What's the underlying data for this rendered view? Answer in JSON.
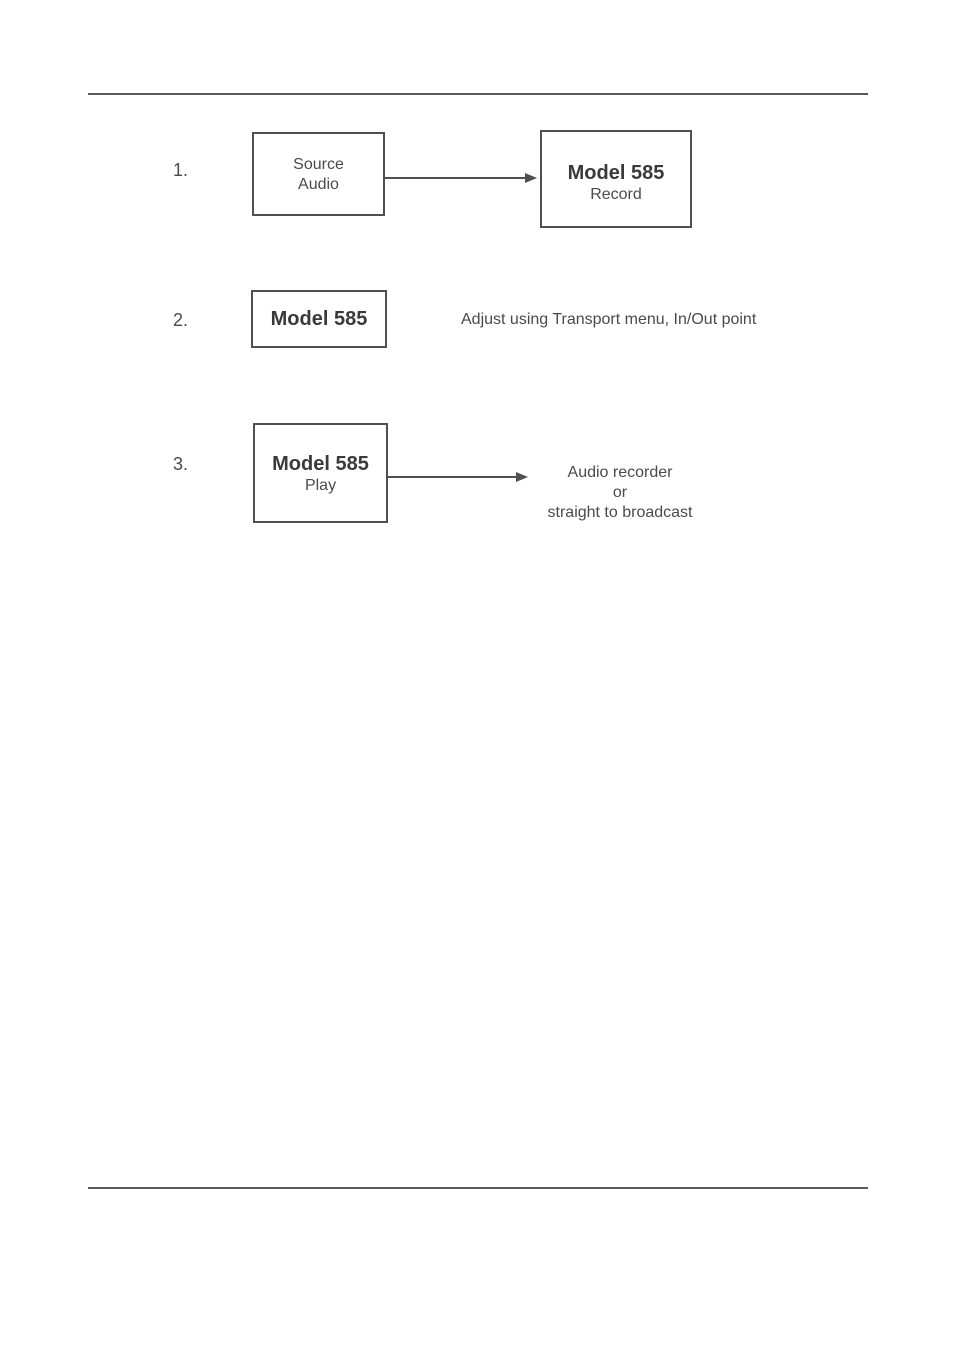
{
  "steps": {
    "s1": {
      "num": "1.",
      "leftBox": {
        "line1": "Source",
        "line2": "Audio"
      },
      "rightBox": {
        "title": "Model 585",
        "sub": "Record"
      }
    },
    "s2": {
      "num": "2.",
      "box": {
        "title": "Model 585"
      },
      "text": "Adjust using Transport menu, In/Out point"
    },
    "s3": {
      "num": "3.",
      "box": {
        "title": "Model 585",
        "sub": "Play"
      },
      "text": "Audio recorder\nor\nstraight to broadcast"
    }
  }
}
